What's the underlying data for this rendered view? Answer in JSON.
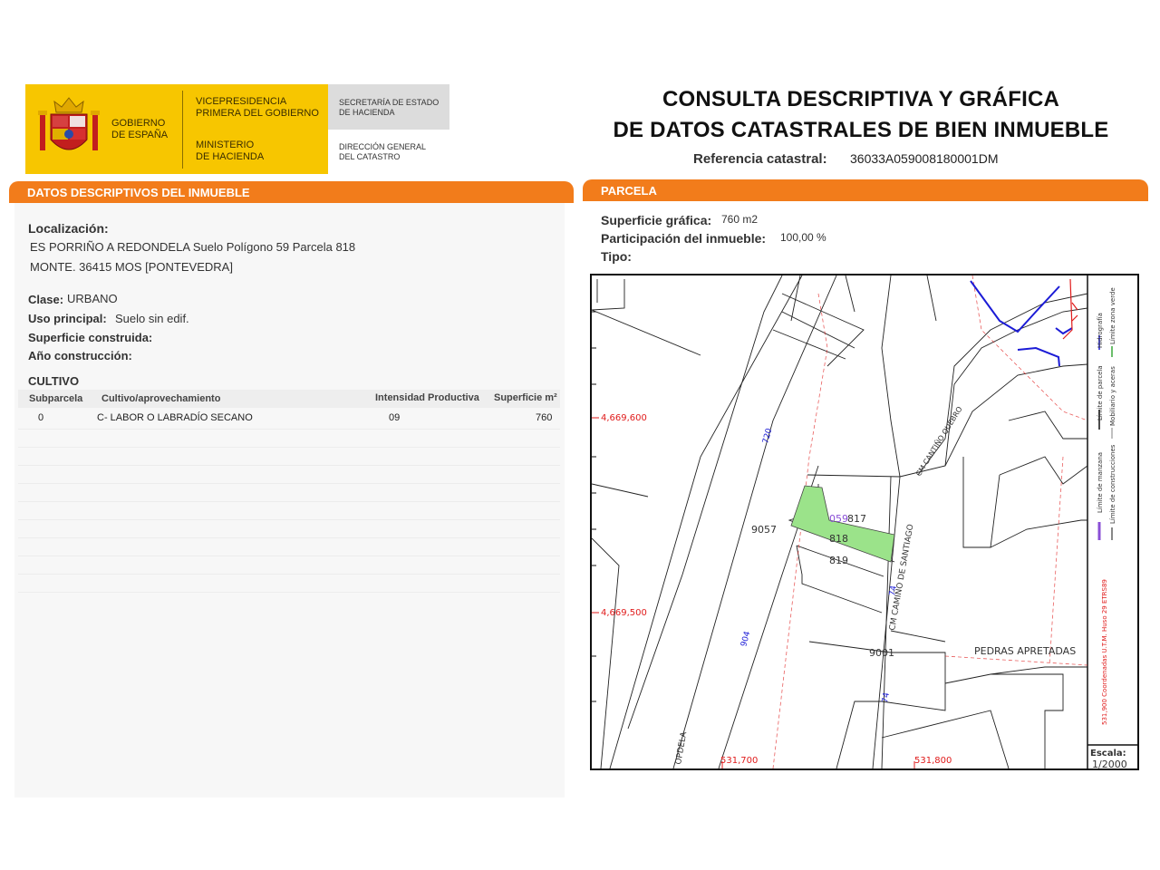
{
  "header": {
    "gov_line1": "GOBIERNO",
    "gov_line2": "DE ESPAÑA",
    "vice_line1": "VICEPRESIDENCIA",
    "vice_line2": "PRIMERA DEL GOBIERNO",
    "min_line1": "MINISTERIO",
    "min_line2": "DE HACIENDA",
    "sec_line1": "SECRETARÍA DE ESTADO",
    "sec_line2": "DE HACIENDA",
    "dir_line1": "DIRECCIÓN GENERAL",
    "dir_line2": "DEL CATASTRO"
  },
  "title": {
    "line1": "CONSULTA DESCRIPTIVA Y GRÁFICA",
    "line2": "DE DATOS CATASTRALES DE BIEN INMUEBLE",
    "ref_label": "Referencia catastral:",
    "ref_value": "36033A059008180001DM"
  },
  "descriptivos": {
    "bar_title": "DATOS DESCRIPTIVOS DEL INMUEBLE",
    "localizacion_label": "Localización:",
    "localizacion_line1": "ES PORRIÑO A REDONDELA  Suelo Polígono 59 Parcela 818",
    "localizacion_line2": "MONTE. 36415 MOS [PONTEVEDRA]",
    "clase_label": "Clase:",
    "clase_value": "URBANO",
    "uso_label": "Uso principal:",
    "uso_value": "Suelo sin edif.",
    "superficie_label": "Superficie construida:",
    "anio_label": "Año construcción:",
    "cultivo_title": "CULTIVO",
    "columns": [
      "Subparcela",
      "Cultivo/aprovechamiento",
      "Intensidad Productiva",
      "Superficie m²"
    ],
    "rows": [
      {
        "subparcela": "0",
        "cultivo": "C- LABOR O LABRADÍO  SECANO",
        "intensidad": "09",
        "superficie": "760"
      }
    ]
  },
  "parcela": {
    "bar_title": "PARCELA",
    "sup_label": "Superficie gráfica:",
    "sup_value": "760 m2",
    "part_label": "Participación del inmueble:",
    "part_value": "100,00 %",
    "tipo_label": "Tipo:"
  },
  "map": {
    "labels": {
      "y_top": "4,669,600",
      "y_bottom": "4,669,500",
      "x_left": "531,700",
      "x_right": "531,800",
      "p9057": "9057",
      "p817": "817",
      "p818": "818",
      "p819": "819",
      "p9001": "9001",
      "p059": "059",
      "pedras": "PEDRAS APRETADAS",
      "cami_santiago": "CM CAMIÑO DE SANTIAGO",
      "cami_cantiño": "CM CANTIÑO QUEBRO",
      "road_n1": "720",
      "road_n2": "904",
      "road_n3": "74",
      "road_n4": "74",
      "opdela": "OPDELA"
    },
    "legend": {
      "hidrografia": "Hidrografía",
      "limite_zona_verde": "Límite zona verde",
      "limite_parcela": "Límite de parcela",
      "mobiliario": "Mobiliario y aceras",
      "limite_manzana": "Límite de manzana",
      "limite_construcciones": "Límite de construcciones",
      "coords": "531,900 Coordenadas U.T.M. Huso 29 ETRS89"
    },
    "escala_label": "Escala:",
    "escala_value": "1/2000",
    "colors": {
      "parcel_fill": "#9be38a",
      "hydro": "#1b1bd6",
      "grid": "#e01b1b",
      "accent": "#f27c1b"
    }
  }
}
